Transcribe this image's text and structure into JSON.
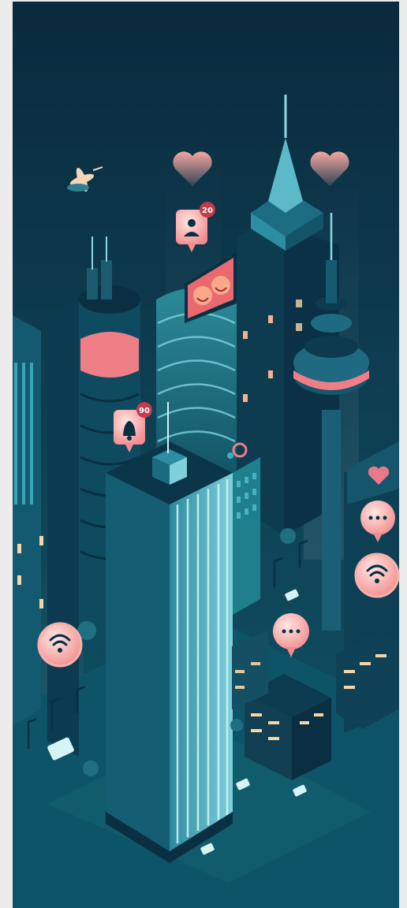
{
  "scene": {
    "colors": {
      "frame": "#ececec",
      "sky_top": "#0b2f44",
      "sky_bottom": "#114e62",
      "ground": "#0e5769",
      "tower_dark": "#0a2f42",
      "tower_mid": "#1b6a7e",
      "tower_light": "#5fb7c6",
      "accent_pink": "#f07e86",
      "accent_light": "#ffd9d2",
      "window_warm": "#f6d6a6"
    }
  },
  "badges": {
    "user_count": "20",
    "notification_count": "90"
  },
  "icons": {
    "user": "user-icon",
    "bell": "bell-icon",
    "heart": "heart-icon",
    "wifi": "wifi-icon",
    "chat": "chat-icon",
    "drone": "drone-icon",
    "billboard": "emoji-billboard-icon"
  }
}
